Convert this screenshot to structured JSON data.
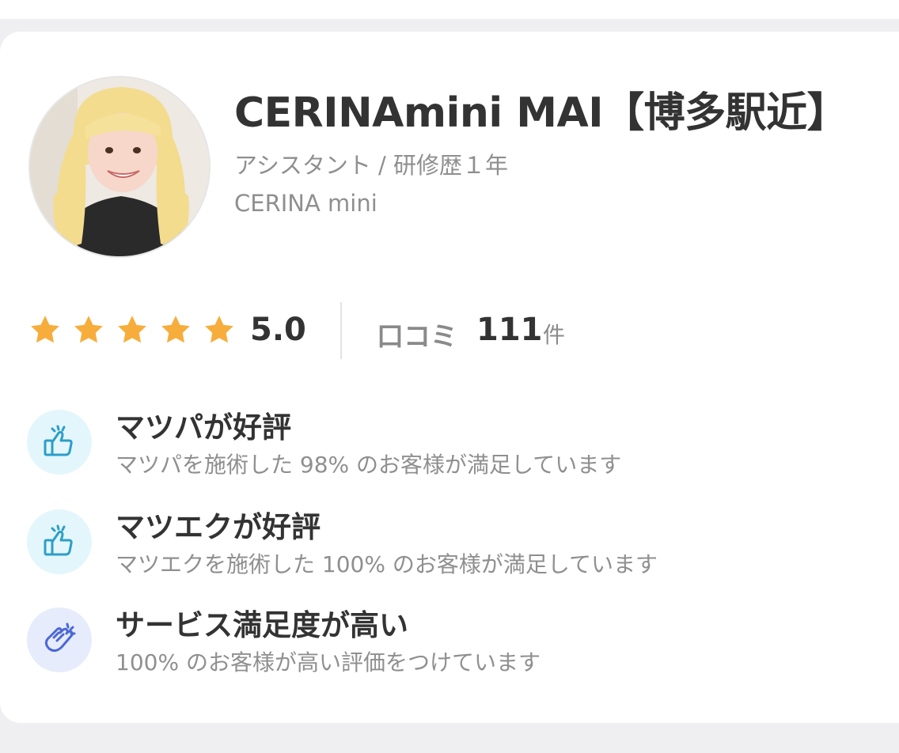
{
  "staff": {
    "name": "CERINAmini MAI【博多駅近】",
    "role": "アシスタント / 研修歴１年",
    "salon": "CERINA mini"
  },
  "rating": {
    "value": "5.0",
    "stars": 5,
    "star_color": "#f7ad3c"
  },
  "reviews": {
    "label": "口コミ",
    "count": "111",
    "unit": "件"
  },
  "features": [
    {
      "title": "マツパが好評",
      "desc": "マツパを施術した 98% のお客様が満足しています",
      "icon": "thumbs-up-icon",
      "icon_bg": "#e3f6fb",
      "icon_color": "#2c9ec8"
    },
    {
      "title": "マツエクが好評",
      "desc": "マツエクを施術した 100% のお客様が満足しています",
      "icon": "thumbs-up-icon",
      "icon_bg": "#e3f6fb",
      "icon_color": "#2c9ec8"
    },
    {
      "title": "サービス満足度が高い",
      "desc": "100% のお客様が高い評価をつけています",
      "icon": "clapping-hands-icon",
      "icon_bg": "#e6ecfb",
      "icon_color": "#4a68d6"
    }
  ]
}
